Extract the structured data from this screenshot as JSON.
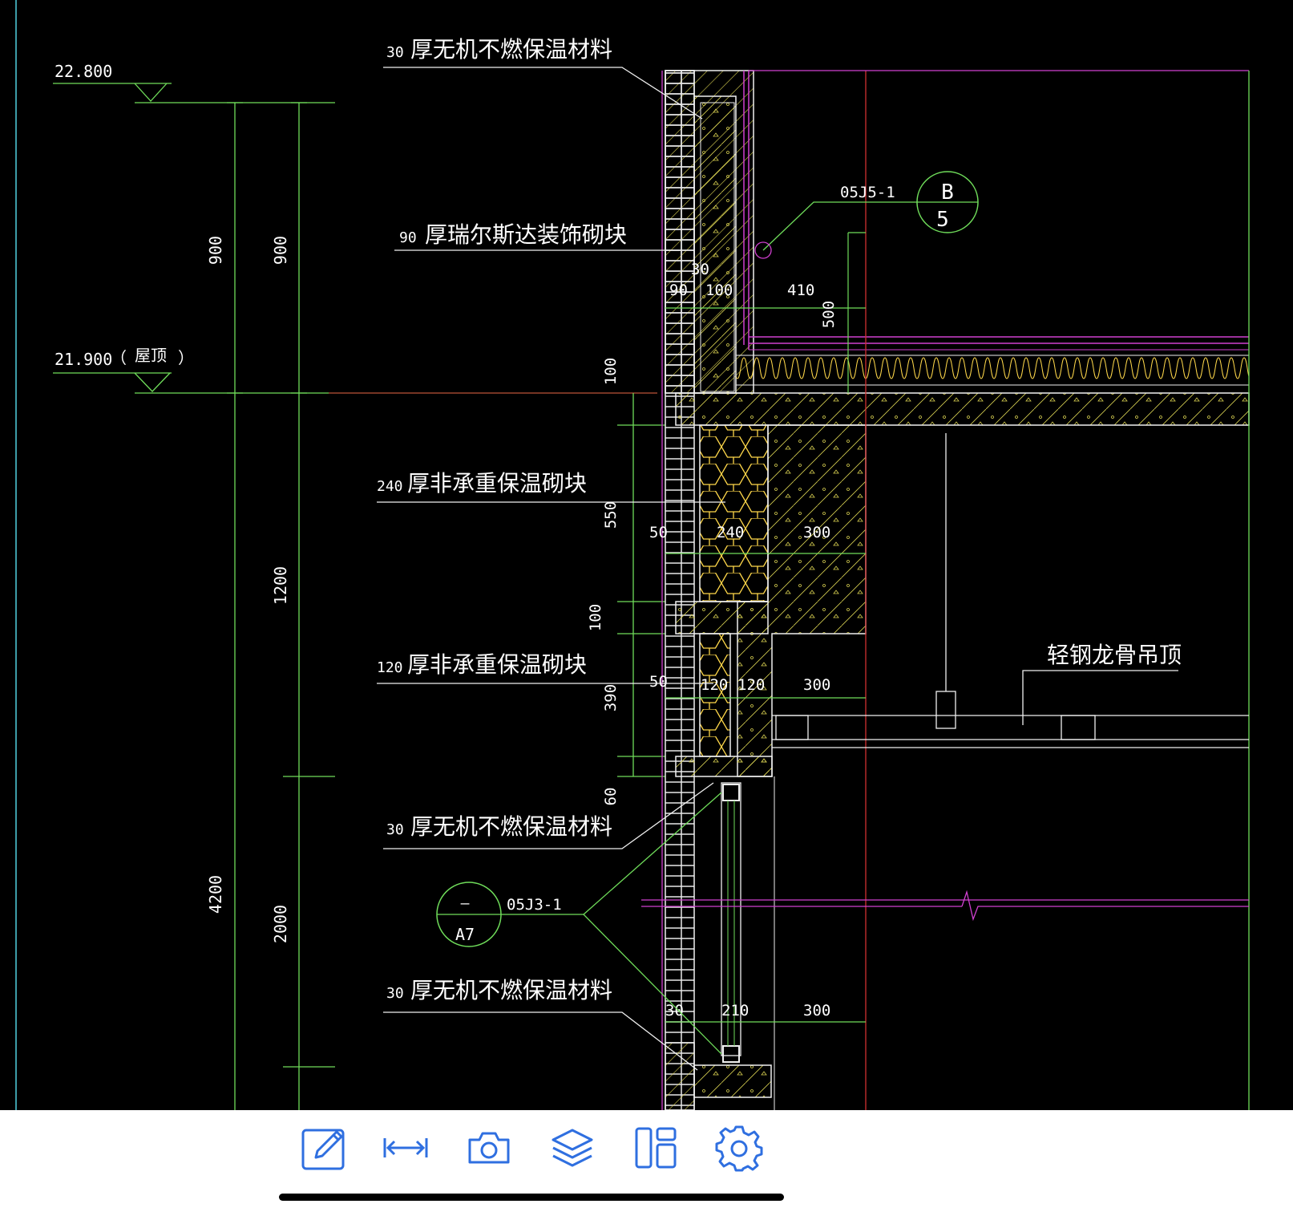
{
  "drawing": {
    "elevations": {
      "top_value": "22.800",
      "roof_value": "21.900",
      "roof_open": "（",
      "roof_label": "屋顶",
      "roof_close": "）"
    },
    "dimensions_left": {
      "outer_upper": "900",
      "outer_lower": "4200",
      "inner_upper": "900",
      "inner_middle": "1200",
      "inner_lower": "2000"
    },
    "dimensions_small": {
      "d100_upper": "100",
      "d550": "550",
      "d100_lower": "100",
      "d390": "390",
      "d60": "60"
    },
    "labels": {
      "label_1_num": "30",
      "label_1_text": "厚无机不燃保温材料",
      "label_2_num": "90",
      "label_2_text": "厚瑞尔斯达装饰砌块",
      "label_3_num": "240",
      "label_3_text": "厚非承重保温砌块",
      "label_4_num": "120",
      "label_4_text": "厚非承重保温砌块",
      "label_5_num": "30",
      "label_5_text": "厚无机不燃保温材料",
      "label_6_num": "30",
      "label_6_text": "厚无机不燃保温材料",
      "ceiling_label": "轻钢龙骨吊顶"
    },
    "wall_dims": {
      "d30_top": "30",
      "d90": "90",
      "d100_wall": "100",
      "d410": "410",
      "d500": "500",
      "d50_a": "50",
      "d240": "240",
      "d300_a": "300",
      "d50_b": "50",
      "d120_a": "120",
      "d120_b": "120",
      "d300_b": "300",
      "d30_bottom": "30",
      "d210": "210",
      "d300_c": "300"
    },
    "detail_refs": {
      "ref_b_code": "05J5-1",
      "ref_b_top": "B",
      "ref_b_bottom": "5",
      "ref_a_code": "05J3-1",
      "ref_a_top": "—",
      "ref_a_bottom": "A7"
    }
  },
  "toolbar": {
    "buttons": [
      {
        "icon": "edit-icon"
      },
      {
        "icon": "measure-icon"
      },
      {
        "icon": "camera-icon"
      },
      {
        "icon": "layers-icon"
      },
      {
        "icon": "layout-icon"
      },
      {
        "icon": "settings-icon"
      }
    ],
    "accent_color": "#2f6fe0"
  },
  "colors": {
    "canvas_background": "#000000",
    "dimension_line": "#6fdc5a",
    "wall_outline": "#f0f0f0",
    "hatch": "#d8d050",
    "insulation_block": "#ffd84a",
    "magenta_line": "#d040d0",
    "red_axis": "#d03030",
    "cyan_line": "#50d0e0"
  }
}
